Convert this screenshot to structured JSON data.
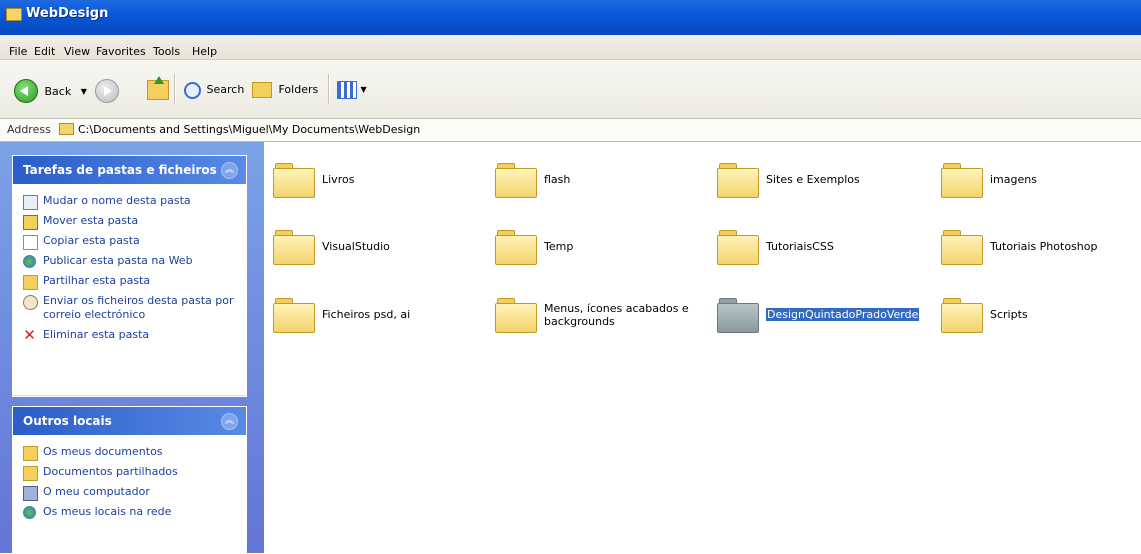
{
  "window": {
    "title": "WebDesign"
  },
  "menu": [
    "File",
    "Edit",
    "View",
    "Favorites",
    "Tools",
    "Help"
  ],
  "toolbar": {
    "back_label": "Back",
    "search_label": "Search",
    "folders_label": "Folders"
  },
  "address": {
    "label": "Address",
    "path": "C:\\Documents and Settings\\Miguel\\My Documents\\WebDesign"
  },
  "tasks_panel": {
    "title": "Tarefas de pastas e ficheiros",
    "items": [
      {
        "label": "Mudar o nome desta pasta",
        "icon": "rename-icon"
      },
      {
        "label": "Mover esta pasta",
        "icon": "move-icon"
      },
      {
        "label": "Copiar esta pasta",
        "icon": "copy-icon"
      },
      {
        "label": "Publicar esta pasta na Web",
        "icon": "publish-web-icon"
      },
      {
        "label": "Partilhar esta pasta",
        "icon": "share-icon"
      },
      {
        "label": "Enviar os ficheiros desta pasta por correio electrónico",
        "icon": "email-icon"
      },
      {
        "label": "Eliminar esta pasta",
        "icon": "delete-icon"
      }
    ]
  },
  "other_places": {
    "title": "Outros locais",
    "items": [
      {
        "label": "Os meus documentos",
        "icon": "my-documents-icon"
      },
      {
        "label": "Documentos partilhados",
        "icon": "shared-documents-icon"
      },
      {
        "label": "O meu computador",
        "icon": "my-computer-icon"
      },
      {
        "label": "Os meus locais na rede",
        "icon": "network-places-icon"
      }
    ]
  },
  "folders": [
    {
      "name": "Livros"
    },
    {
      "name": "flash"
    },
    {
      "name": "Sites e Exemplos"
    },
    {
      "name": "imagens"
    },
    {
      "name": "VisualStudio"
    },
    {
      "name": "Temp"
    },
    {
      "name": "TutoriaisCSS"
    },
    {
      "name": "Tutoriais Photoshop"
    },
    {
      "name": "Ficheiros psd, ai"
    },
    {
      "name": "Menus, ícones acabados e backgrounds"
    },
    {
      "name": "DesignQuintadoPradoVerde",
      "selected": true
    },
    {
      "name": "Scripts"
    }
  ]
}
